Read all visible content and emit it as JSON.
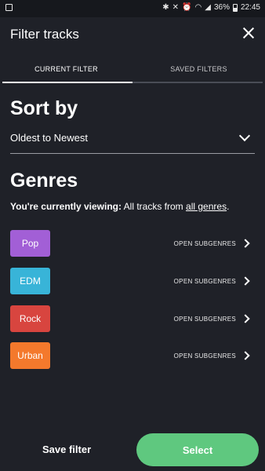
{
  "status_bar": {
    "battery": "36%",
    "time": "22:45"
  },
  "header": {
    "title": "Filter tracks"
  },
  "tabs": [
    {
      "label": "CURRENT FILTER",
      "active": true
    },
    {
      "label": "SAVED FILTERS",
      "active": false
    }
  ],
  "sort": {
    "heading": "Sort by",
    "selected": "Oldest to Newest"
  },
  "genres": {
    "heading": "Genres",
    "viewing_prefix": "You're currently viewing:",
    "viewing_middle": "All tracks from",
    "viewing_link": "all genres",
    "viewing_suffix": ".",
    "open_subgenres_label": "OPEN SUBGENRES",
    "items": [
      {
        "label": "Pop",
        "color": "#a25fd6"
      },
      {
        "label": "EDM",
        "color": "#38b4d8"
      },
      {
        "label": "Rock",
        "color": "#d8453f"
      },
      {
        "label": "Urban",
        "color": "#f4792c"
      }
    ]
  },
  "footer": {
    "save_label": "Save filter",
    "select_label": "Select"
  },
  "colors": {
    "background": "#1f2128",
    "accent_green": "#5fc87f"
  }
}
